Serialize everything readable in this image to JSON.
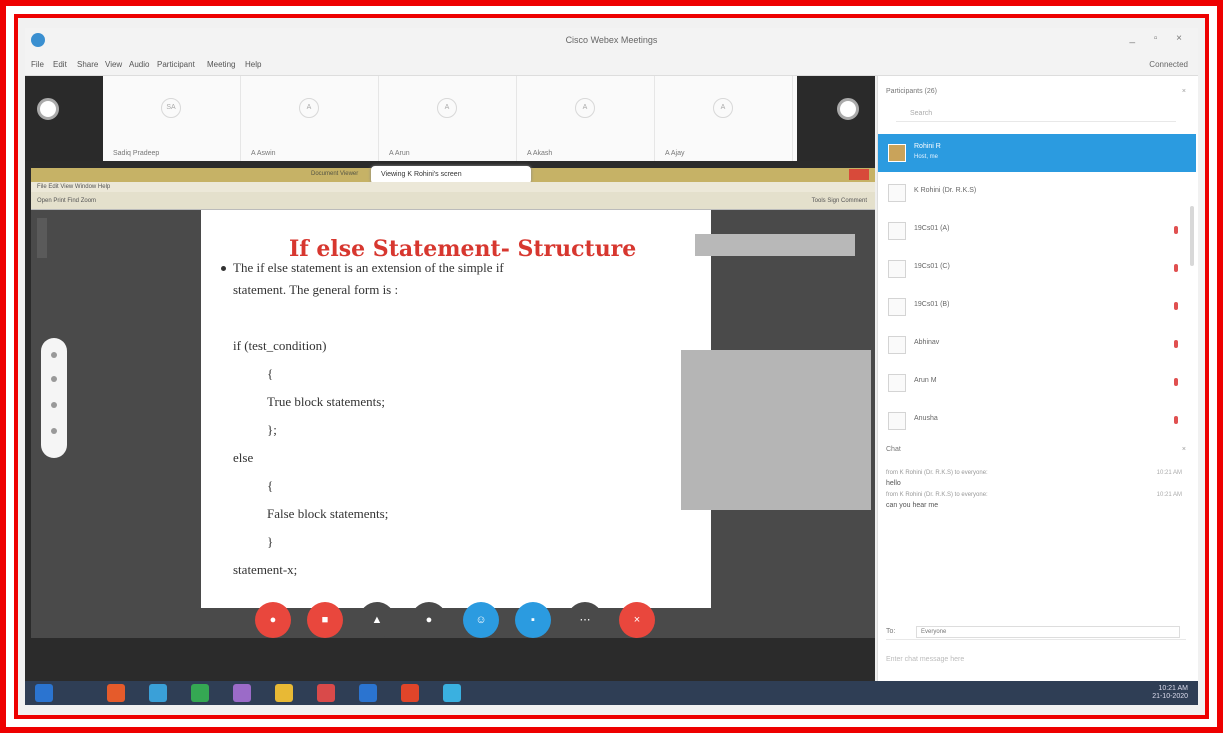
{
  "window": {
    "title": "Cisco Webex Meetings",
    "controls": "_ ▫ ×",
    "connection_status": "Connected"
  },
  "menu": [
    "File",
    "Edit",
    "Share",
    "View",
    "Audio",
    "Participant",
    "Meeting",
    "Help"
  ],
  "filmstrip": {
    "thumbs": [
      {
        "initial": "SA",
        "label": "Sadiq Pradeep"
      },
      {
        "initial": "A",
        "label": "A Aswin"
      },
      {
        "initial": "A",
        "label": "A Arun"
      },
      {
        "initial": "A",
        "label": "A Akash"
      },
      {
        "initial": "A",
        "label": "A Ajay"
      }
    ]
  },
  "share": {
    "window_title": "Document Viewer",
    "sharing_label": "Viewing K Rohini's screen",
    "viewer_menu": "File  Edit  View  Window  Help",
    "viewer_tools": "Open  Print  Find  Zoom",
    "viewer_tools_right": "Tools  Sign  Comment"
  },
  "slide": {
    "title": "If else Statement- Structure",
    "bullet_line1": "The if else statement is an extension of the simple if",
    "bullet_line2": "statement. The general form is :",
    "code": [
      "if (test_condition)",
      "{",
      "True block statements;",
      "};",
      "else",
      "{",
      "False block statements;",
      "}",
      "statement-x;"
    ]
  },
  "controls": [
    {
      "name": "mute",
      "glyph": "●",
      "color": "#e9473d"
    },
    {
      "name": "video",
      "glyph": "■",
      "color": "#e9473d"
    },
    {
      "name": "share",
      "glyph": "▲",
      "color": "#4a4a4a"
    },
    {
      "name": "record",
      "glyph": "●",
      "color": "#4a4a4a"
    },
    {
      "name": "participants",
      "glyph": "☺",
      "color": "#2b9be0"
    },
    {
      "name": "chat",
      "glyph": "▪",
      "color": "#2b9be0"
    },
    {
      "name": "more",
      "glyph": "⋯",
      "color": "#4a4a4a"
    },
    {
      "name": "leave",
      "glyph": "×",
      "color": "#e9473d"
    }
  ],
  "participants": {
    "header": "Participants (26)",
    "search_placeholder": "Search",
    "list": [
      {
        "name": "Rohini R",
        "role": "Host, me",
        "selected": true
      },
      {
        "name": "K Rohini (Dr. R.K.S)",
        "role": "",
        "selected": false
      },
      {
        "name": "19Cs01 (A)",
        "role": "",
        "selected": false
      },
      {
        "name": "19Cs01 (C)",
        "role": "",
        "selected": false
      },
      {
        "name": "19Cs01 (B)",
        "role": "",
        "selected": false
      },
      {
        "name": "Abhinav",
        "role": "",
        "selected": false
      },
      {
        "name": "Arun M",
        "role": "",
        "selected": false
      },
      {
        "name": "Anusha",
        "role": "",
        "selected": false
      }
    ]
  },
  "chat": {
    "header": "Chat",
    "messages": [
      {
        "from": "from K Rohini (Dr. R.K.S) to everyone:",
        "time": "10:21 AM",
        "text": "hello"
      },
      {
        "from": "from K Rohini (Dr. R.K.S) to everyone:",
        "time": "10:21 AM",
        "text": "can you hear me"
      }
    ],
    "to_label": "To:",
    "to_value": "Everyone",
    "input_placeholder": "Enter chat message here"
  },
  "taskbar": {
    "icons": [
      "#2b74d0",
      "#e55b2b",
      "#3aa0d8",
      "#35a853",
      "#9b6bc8",
      "#e8b935",
      "#d94a4a",
      "#2b74d0",
      "#e0452a",
      "#3ab0e0"
    ],
    "time": "10:21 AM",
    "date": "21-10-2020"
  }
}
